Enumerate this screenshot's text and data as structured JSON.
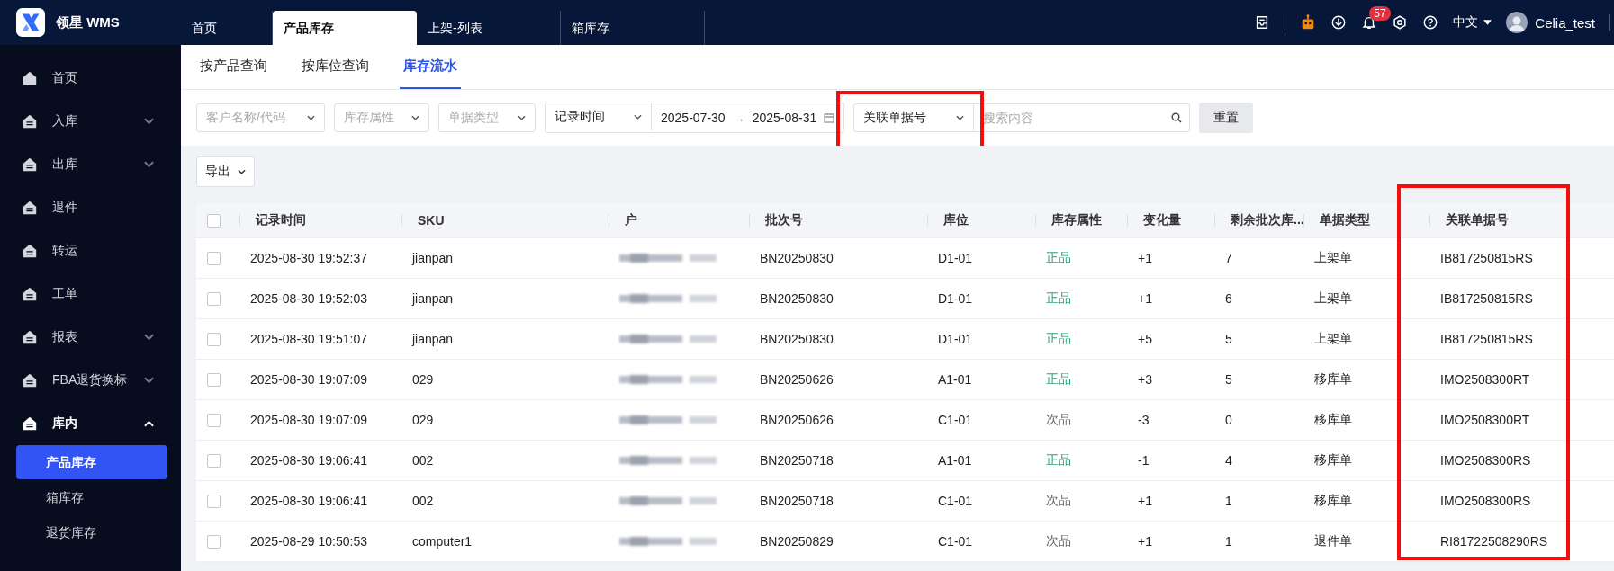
{
  "brand": {
    "name": "领星 WMS"
  },
  "top_tabs": [
    {
      "label": "首页",
      "selected": false
    },
    {
      "label": "产品库存",
      "selected": true
    },
    {
      "label": "上架-列表",
      "selected": false
    },
    {
      "label": "箱库存",
      "selected": false
    }
  ],
  "top_bar": {
    "notification_count": "57",
    "language": "中文",
    "user": "Celia_test"
  },
  "sidebar": {
    "items": [
      {
        "label": "首页",
        "selected": false
      },
      {
        "label": "入库",
        "selected": false,
        "expanded": false
      },
      {
        "label": "出库",
        "selected": false,
        "expanded": false
      },
      {
        "label": "退件",
        "selected": false
      },
      {
        "label": "转运",
        "selected": false
      },
      {
        "label": "工单",
        "selected": false
      },
      {
        "label": "报表",
        "selected": false,
        "expanded": false
      },
      {
        "label": "FBA退货换标",
        "selected": false,
        "expanded": false
      },
      {
        "label": "库内",
        "selected": true,
        "expanded": true,
        "children": [
          {
            "label": "产品库存",
            "selected": true
          },
          {
            "label": "箱库存",
            "selected": false
          },
          {
            "label": "退货库存",
            "selected": false
          }
        ]
      }
    ]
  },
  "sub_tabs": [
    {
      "label": "按产品查询",
      "selected": false
    },
    {
      "label": "按库位查询",
      "selected": false
    },
    {
      "label": "库存流水",
      "selected": true
    }
  ],
  "filters": {
    "selects": [
      {
        "placeholder": "客户名称/代码"
      },
      {
        "placeholder": "库存属性"
      },
      {
        "placeholder": "单据类型"
      }
    ],
    "date_field": {
      "value": "记录时间"
    },
    "date_range": {
      "start": "2025-07-30",
      "separator": "→",
      "end": "2025-08-31"
    },
    "search_field": {
      "value": "关联单据号",
      "highlighted": true
    },
    "search": {
      "placeholder": "搜索内容"
    },
    "reset_button": "重置"
  },
  "export_button": "导出",
  "table": {
    "all_checked": false,
    "columns": [
      {
        "label": "记录时间"
      },
      {
        "label": "SKU"
      },
      {
        "label": "户"
      },
      {
        "label": "批次号"
      },
      {
        "label": "库位"
      },
      {
        "label": "库存属性"
      },
      {
        "label": "变化量"
      },
      {
        "label": "剩余批次库..."
      },
      {
        "label": "单据类型"
      },
      {
        "label": "关联单据号",
        "highlighted": true
      }
    ],
    "rows": [
      {
        "checked": false,
        "time": "2025-08-30 19:52:37",
        "sku": "jianpan",
        "batch": "BN20250830",
        "location": "D1-01",
        "attribute": {
          "text": "正品",
          "color": "#2ba471"
        },
        "change": "+1",
        "remaining": "7",
        "doc_type": "上架单",
        "ref": "IB817250815RS"
      },
      {
        "checked": false,
        "time": "2025-08-30 19:52:03",
        "sku": "jianpan",
        "batch": "BN20250830",
        "location": "D1-01",
        "attribute": {
          "text": "正品",
          "color": "#2ba471"
        },
        "change": "+1",
        "remaining": "6",
        "doc_type": "上架单",
        "ref": "IB817250815RS"
      },
      {
        "checked": false,
        "time": "2025-08-30 19:51:07",
        "sku": "jianpan",
        "batch": "BN20250830",
        "location": "D1-01",
        "attribute": {
          "text": "正品",
          "color": "#2ba471"
        },
        "change": "+5",
        "remaining": "5",
        "doc_type": "上架单",
        "ref": "IB817250815RS"
      },
      {
        "checked": false,
        "time": "2025-08-30 19:07:09",
        "sku": "029",
        "batch": "BN20250626",
        "location": "A1-01",
        "attribute": {
          "text": "正品",
          "color": "#2ba471"
        },
        "change": "+3",
        "remaining": "5",
        "doc_type": "移库单",
        "ref": "IMO2508300RT"
      },
      {
        "checked": false,
        "time": "2025-08-30 19:07:09",
        "sku": "029",
        "batch": "BN20250626",
        "location": "C1-01",
        "attribute": {
          "text": "次品",
          "color": "#666666"
        },
        "change": "-3",
        "remaining": "0",
        "doc_type": "移库单",
        "ref": "IMO2508300RT"
      },
      {
        "checked": false,
        "time": "2025-08-30 19:06:41",
        "sku": "002",
        "batch": "BN20250718",
        "location": "A1-01",
        "attribute": {
          "text": "正品",
          "color": "#2ba471"
        },
        "change": "-1",
        "remaining": "4",
        "doc_type": "移库单",
        "ref": "IMO2508300RS"
      },
      {
        "checked": false,
        "time": "2025-08-30 19:06:41",
        "sku": "002",
        "batch": "BN20250718",
        "location": "C1-01",
        "attribute": {
          "text": "次品",
          "color": "#666666"
        },
        "change": "+1",
        "remaining": "1",
        "doc_type": "移库单",
        "ref": "IMO2508300RS"
      },
      {
        "checked": false,
        "time": "2025-08-29 10:50:53",
        "sku": "computer1",
        "batch": "BN20250829",
        "location": "C1-01",
        "attribute": {
          "text": "次品",
          "color": "#666666"
        },
        "change": "+1",
        "remaining": "1",
        "doc_type": "退件单",
        "ref": "RI81722508290RS"
      }
    ]
  }
}
